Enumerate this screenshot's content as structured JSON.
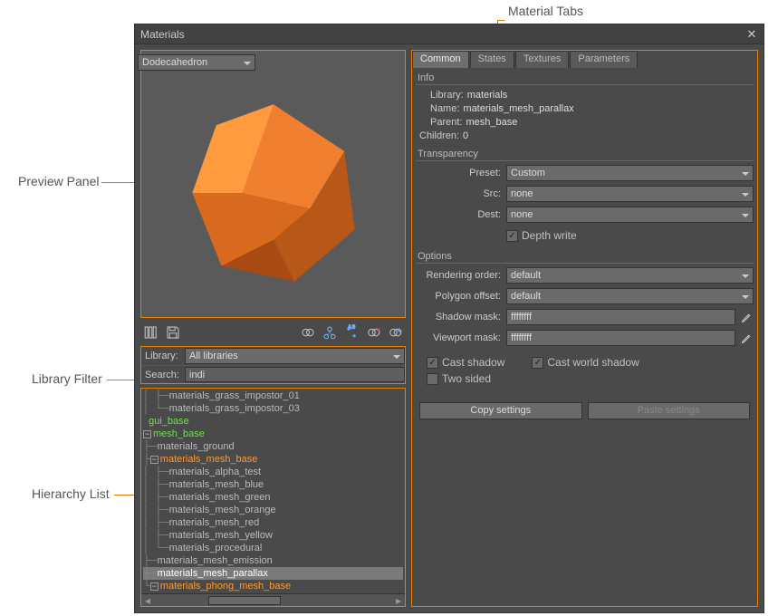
{
  "annotations": {
    "material_tabs": "Material Tabs",
    "preview_panel": "Preview Panel",
    "library_filter": "Library Filter",
    "hierarchy_list": "Hierarchy List"
  },
  "window": {
    "title": "Materials"
  },
  "preview": {
    "shape": "Dodecahedron"
  },
  "filter": {
    "library_label": "Library:",
    "library_value": "All libraries",
    "search_label": "Search:",
    "search_value": "indi"
  },
  "tree": {
    "items": [
      "materials_grass_impostor_01",
      "materials_grass_impostor_03",
      "gui_base",
      "mesh_base",
      "materials_ground",
      "materials_mesh_base",
      "materials_alpha_test",
      "materials_mesh_blue",
      "materials_mesh_green",
      "materials_mesh_orange",
      "materials_mesh_red",
      "materials_mesh_yellow",
      "materials_procedural",
      "materials_mesh_emission",
      "materials_mesh_parallax",
      "materials_phong_mesh_base"
    ]
  },
  "tabs": [
    "Common",
    "States",
    "Textures",
    "Parameters"
  ],
  "info": {
    "group": "Info",
    "library_label": "Library:",
    "library": "materials",
    "name_label": "Name:",
    "name": "materials_mesh_parallax",
    "parent_label": "Parent:",
    "parent": "mesh_base",
    "children_label": "Children:",
    "children": "0"
  },
  "transparency": {
    "group": "Transparency",
    "preset_label": "Preset:",
    "preset": "Custom",
    "src_label": "Src:",
    "src": "none",
    "dest_label": "Dest:",
    "dest": "none",
    "depth_write": "Depth write"
  },
  "options": {
    "group": "Options",
    "rendering_order_label": "Rendering order:",
    "rendering_order": "default",
    "polygon_offset_label": "Polygon offset:",
    "polygon_offset": "default",
    "shadow_mask_label": "Shadow mask:",
    "shadow_mask": "ffffffff",
    "viewport_mask_label": "Viewport mask:",
    "viewport_mask": "ffffffff",
    "cast_shadow": "Cast shadow",
    "cast_world_shadow": "Cast world shadow",
    "two_sided": "Two sided"
  },
  "buttons": {
    "copy": "Copy settings",
    "paste": "Paste settings"
  }
}
